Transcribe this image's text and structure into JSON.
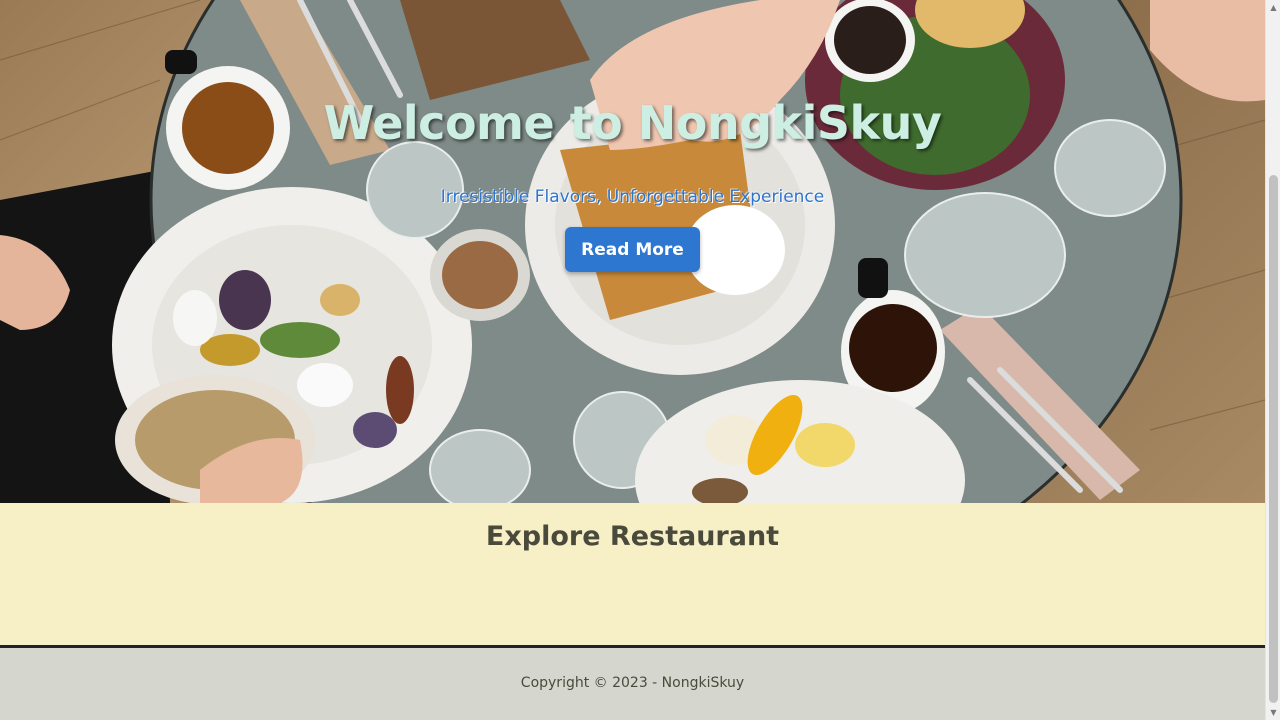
{
  "hero": {
    "title": "Welcome to NongkiSkuy",
    "subtitle": "Irresistible Flavors, Unforgettable Experience",
    "read_more_label": "Read More"
  },
  "explore": {
    "heading": "Explore Restaurant"
  },
  "footer": {
    "copyright": "Copyright © 2023 - NongkiSkuy"
  },
  "scrollbar": {
    "up_glyph": "▲",
    "down_glyph": "▼"
  },
  "colors": {
    "hero_title": "#cdeee2",
    "subtitle": "#2d74cf",
    "button_bg": "#2e77d0",
    "explore_bg": "#f7efc6",
    "footer_bg": "#d5d7cf",
    "text_dark": "#4a4a3c"
  }
}
